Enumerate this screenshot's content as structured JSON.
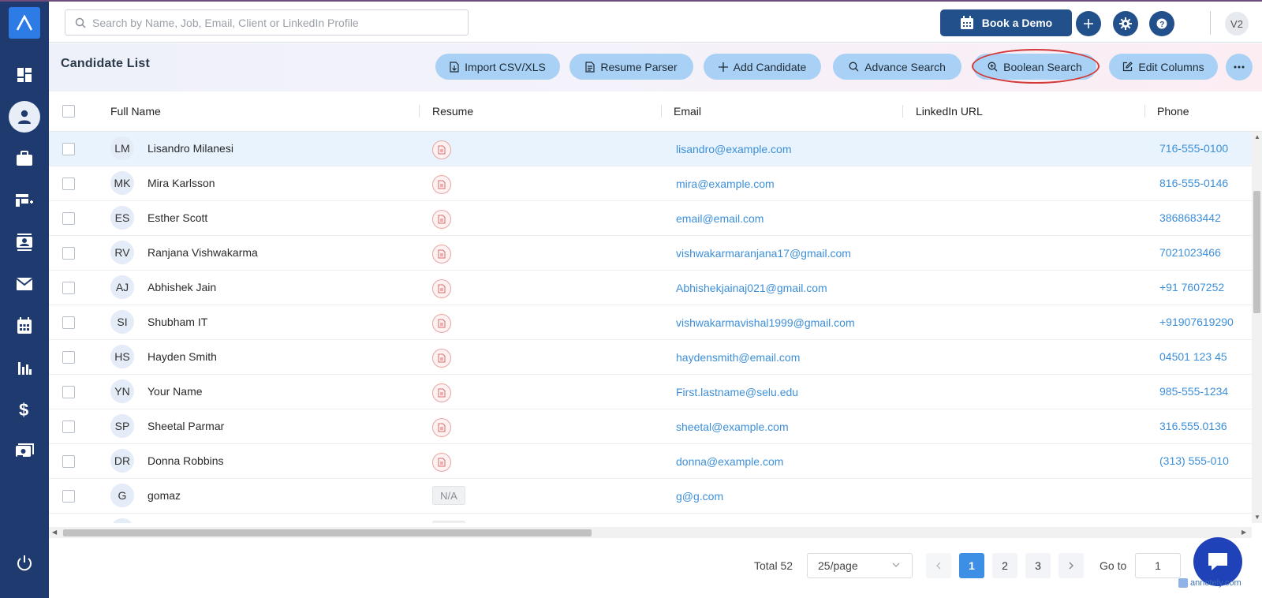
{
  "search": {
    "placeholder": "Search by Name, Job, Email, Client or LinkedIn Profile"
  },
  "header": {
    "book_demo_label": "Book a Demo",
    "user_initials": "V2"
  },
  "subbar": {
    "title": "Candidate List",
    "actions": [
      {
        "label": "Import CSV/XLS",
        "icon": "import-file-icon"
      },
      {
        "label": "Resume Parser",
        "icon": "document-icon"
      },
      {
        "label": "Add Candidate",
        "icon": "plus-icon"
      },
      {
        "label": "Advance Search",
        "icon": "search-icon"
      },
      {
        "label": "Boolean Search",
        "icon": "search-plus-icon"
      },
      {
        "label": "Edit Columns",
        "icon": "edit-icon"
      }
    ]
  },
  "table": {
    "columns": [
      "Full Name",
      "Resume",
      "Email",
      "LinkedIn URL",
      "Phone"
    ],
    "rows": [
      {
        "initials": "LM",
        "name": "Lisandro Milanesi",
        "resume": true,
        "email": "lisandro@example.com",
        "phone": "716-555-0100"
      },
      {
        "initials": "MK",
        "name": "Mira Karlsson",
        "resume": true,
        "email": "mira@example.com",
        "phone": "816-555-0146"
      },
      {
        "initials": "ES",
        "name": "Esther Scott",
        "resume": true,
        "email": "email@email.com",
        "phone": "3868683442"
      },
      {
        "initials": "RV",
        "name": "Ranjana Vishwakarma",
        "resume": true,
        "email": "vishwakarmaranjana17@gmail.com",
        "phone": "7021023466"
      },
      {
        "initials": "AJ",
        "name": "Abhishek Jain",
        "resume": true,
        "email": "Abhishekjainaj021@gmail.com",
        "phone": "+91 7607252"
      },
      {
        "initials": "SI",
        "name": "Shubham IT",
        "resume": true,
        "email": "vishwakarmavishal1999@gmail.com",
        "phone": "+91907619290"
      },
      {
        "initials": "HS",
        "name": "Hayden Smith",
        "resume": true,
        "email": "haydensmith@email.com",
        "phone": "04501 123 45"
      },
      {
        "initials": "YN",
        "name": "Your Name",
        "resume": true,
        "email": "First.lastname@selu.edu",
        "phone": "985-555-1234"
      },
      {
        "initials": "SP",
        "name": "Sheetal Parmar",
        "resume": true,
        "email": "sheetal@example.com",
        "phone": "316.555.0136"
      },
      {
        "initials": "DR",
        "name": "Donna Robbins",
        "resume": true,
        "email": "donna@example.com",
        "phone": "(313) 555-010"
      },
      {
        "initials": "G",
        "name": "gomaz",
        "resume": false,
        "resume_na": "N/A",
        "email": "g@g.com",
        "phone": ""
      }
    ]
  },
  "pagination": {
    "total_label": "Total 52",
    "page_size": "25/page",
    "pages": [
      "1",
      "2",
      "3"
    ],
    "current_page": "1",
    "goto_label": "Go to",
    "goto_value": "1"
  },
  "watermark": "annotely.com",
  "colors": {
    "sidebar": "#1f3a6e",
    "primary": "#22508a",
    "action_button": "#a9d1f5",
    "link": "#3d8fd8",
    "highlight_ring": "#d23a3a"
  }
}
